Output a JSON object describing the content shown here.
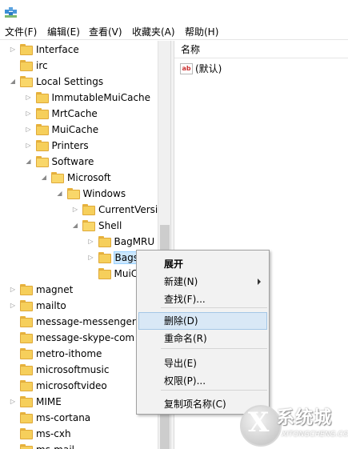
{
  "menubar": {
    "items": [
      "文件(F)",
      "编辑(E)",
      "查看(V)",
      "收藏夹(A)",
      "帮助(H)"
    ]
  },
  "tree": {
    "items": [
      {
        "label": "Interface",
        "expander": "collapsed"
      },
      {
        "label": "irc",
        "expander": "none"
      },
      {
        "label": "Local Settings",
        "expander": "expanded"
      },
      {
        "label": "ImmutableMuiCache",
        "expander": "collapsed"
      },
      {
        "label": "MrtCache",
        "expander": "collapsed"
      },
      {
        "label": "MuiCache",
        "expander": "collapsed"
      },
      {
        "label": "Printers",
        "expander": "collapsed"
      },
      {
        "label": "Software",
        "expander": "expanded"
      },
      {
        "label": "Microsoft",
        "expander": "expanded"
      },
      {
        "label": "Windows",
        "expander": "expanded"
      },
      {
        "label": "CurrentVersio",
        "expander": "collapsed"
      },
      {
        "label": "Shell",
        "expander": "expanded"
      },
      {
        "label": "BagMRU",
        "expander": "collapsed"
      },
      {
        "label": "Bags",
        "expander": "collapsed",
        "selected": true
      },
      {
        "label": "MuiC",
        "expander": "none"
      },
      {
        "label": "magnet",
        "expander": "collapsed"
      },
      {
        "label": "mailto",
        "expander": "collapsed"
      },
      {
        "label": "message-messenger",
        "expander": "none"
      },
      {
        "label": "message-skype-com",
        "expander": "none"
      },
      {
        "label": "metro-ithome",
        "expander": "none"
      },
      {
        "label": "microsoftmusic",
        "expander": "none"
      },
      {
        "label": "microsoftvideo",
        "expander": "none"
      },
      {
        "label": "MIME",
        "expander": "collapsed"
      },
      {
        "label": "ms-cortana",
        "expander": "none"
      },
      {
        "label": "ms-cxh",
        "expander": "none"
      },
      {
        "label": "ms-mail",
        "expander": "none"
      }
    ]
  },
  "values_pane": {
    "column_name": "名称",
    "rows": [
      {
        "icon": "ab",
        "name": "(默认)"
      }
    ]
  },
  "context_menu": {
    "items": [
      {
        "label": "展开",
        "bold": true
      },
      {
        "label": "新建(N)",
        "submenu": true
      },
      {
        "label": "查找(F)..."
      },
      {
        "label": "删除(D)",
        "hover": true
      },
      {
        "label": "重命名(R)"
      },
      {
        "label": "导出(E)"
      },
      {
        "label": "权限(P)..."
      },
      {
        "label": "复制项名称(C)"
      }
    ]
  },
  "watermark": {
    "logo": "X",
    "text": "系统城",
    "url": "XITONGCHENG.COM"
  },
  "colors": {
    "folder": "#f6cf5b",
    "selection": "#cce8ff",
    "menu_hover": "#d9e8f6"
  }
}
